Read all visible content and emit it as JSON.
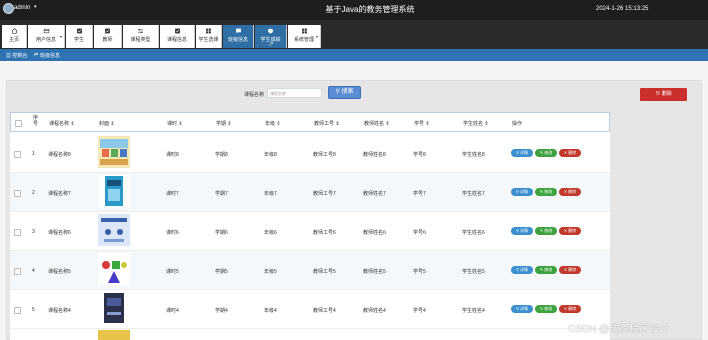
{
  "header": {
    "username": "admin",
    "title": "基于Java的教务管理系统",
    "datetime": "2024-1-26 15:13:25"
  },
  "nav": [
    {
      "label": "主页",
      "icon": "home-icon"
    },
    {
      "label": "用户信息",
      "icon": "card-icon"
    },
    {
      "label": "学生",
      "icon": "check-icon"
    },
    {
      "label": "教师",
      "icon": "check-icon"
    },
    {
      "label": "课程类型",
      "icon": "sliders-icon"
    },
    {
      "label": "课程信息",
      "icon": "check-icon"
    },
    {
      "label": "学生选课",
      "icon": "grid-icon"
    },
    {
      "label": "班级信息",
      "icon": "chat-icon"
    },
    {
      "label": "学生成绩",
      "icon": "shield-icon"
    },
    {
      "label": "系统管理",
      "icon": "grid-icon"
    }
  ],
  "active_nav": "学生成绩",
  "breadcrumb": {
    "home": "控制台",
    "current": "班级信息"
  },
  "search": {
    "label": "课程名称",
    "placeholder": "课程名称",
    "button": "搜索"
  },
  "delete_button": "删除",
  "table": {
    "headers": [
      "序号",
      "课程名称",
      "封面",
      "课时",
      "学期",
      "年级",
      "教师工号",
      "教师姓名",
      "学号",
      "学生姓名",
      "操作"
    ],
    "rows": [
      {
        "no": "1",
        "course": "课程名称8",
        "hours": "课时8",
        "term": "学期8",
        "grade": "年级8",
        "tid": "教师工号8",
        "tname": "教师姓名8",
        "sid": "学号8",
        "sname": "学生姓名8",
        "cover": "cover-cartoon"
      },
      {
        "no": "2",
        "course": "课程名称7",
        "hours": "课时7",
        "term": "学期7",
        "grade": "年级7",
        "tid": "教师工号7",
        "tname": "教师姓名7",
        "sid": "学号7",
        "sname": "学生姓名7",
        "cover": "cover-book"
      },
      {
        "no": "3",
        "course": "课程名称6",
        "hours": "课时6",
        "term": "学期6",
        "grade": "年级6",
        "tid": "教师工号6",
        "tname": "教师姓名6",
        "sid": "学号6",
        "sname": "学生姓名6",
        "cover": "cover-lesson"
      },
      {
        "no": "4",
        "course": "课程名称5",
        "hours": "课时5",
        "term": "学期5",
        "grade": "年级5",
        "tid": "教师工号5",
        "tname": "教师姓名5",
        "sid": "学号5",
        "sname": "学生姓名5",
        "cover": "cover-shapes"
      },
      {
        "no": "5",
        "course": "课程名称4",
        "hours": "课时4",
        "term": "学期4",
        "grade": "年级4",
        "tid": "教师工号4",
        "tname": "教师姓名4",
        "sid": "学号4",
        "sname": "学生姓名4",
        "cover": "cover-darkbook"
      }
    ],
    "actions": {
      "view": "详情",
      "edit": "修改",
      "delete": "删除"
    }
  },
  "watermark": "CSDN @成泽程序设计"
}
